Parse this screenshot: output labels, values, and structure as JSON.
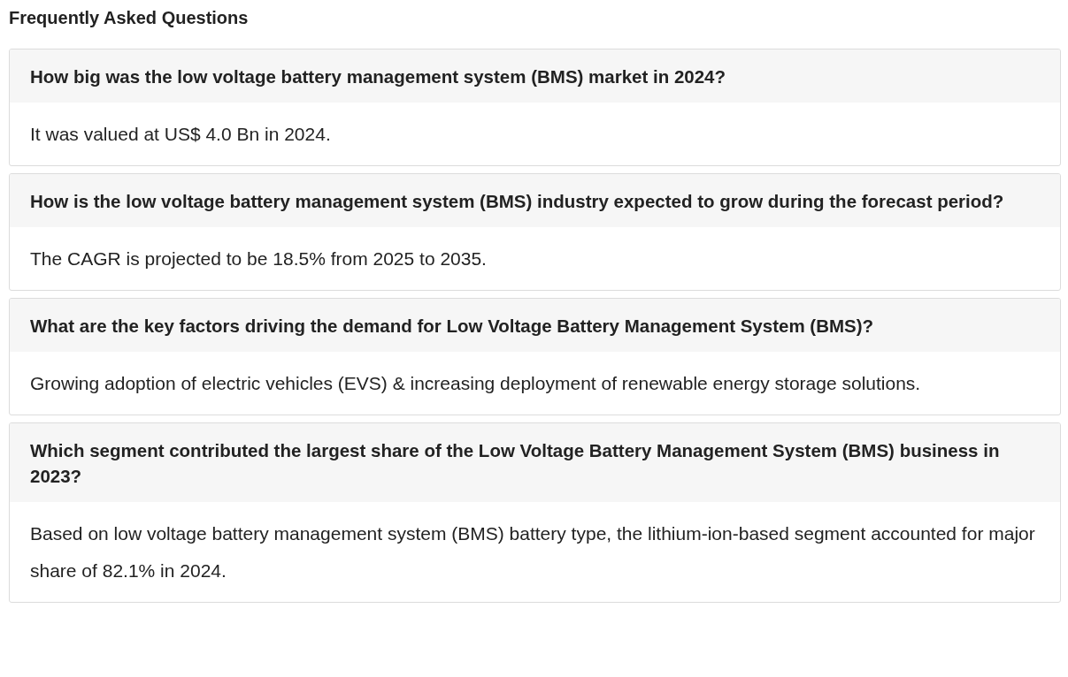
{
  "title": "Frequently Asked Questions",
  "faqs": [
    {
      "question": "How big was the low voltage battery management system (BMS) market in 2024?",
      "answer": "It was valued at US$ 4.0 Bn in 2024."
    },
    {
      "question": "How is the low voltage battery management system (BMS) industry expected to grow during the forecast period?",
      "answer": "The CAGR is projected to be 18.5% from 2025 to 2035."
    },
    {
      "question": "What are the key factors driving the demand for Low Voltage Battery Management System (BMS)?",
      "answer": "Growing adoption of electric vehicles (EVS) & increasing deployment of renewable energy storage solutions."
    },
    {
      "question": "Which segment contributed the largest share of the Low Voltage Battery Management System (BMS) business in 2023?",
      "answer": "Based on low voltage battery management system (BMS) battery type, the lithium-ion-based segment accounted for major share of 82.1% in 2024."
    }
  ]
}
